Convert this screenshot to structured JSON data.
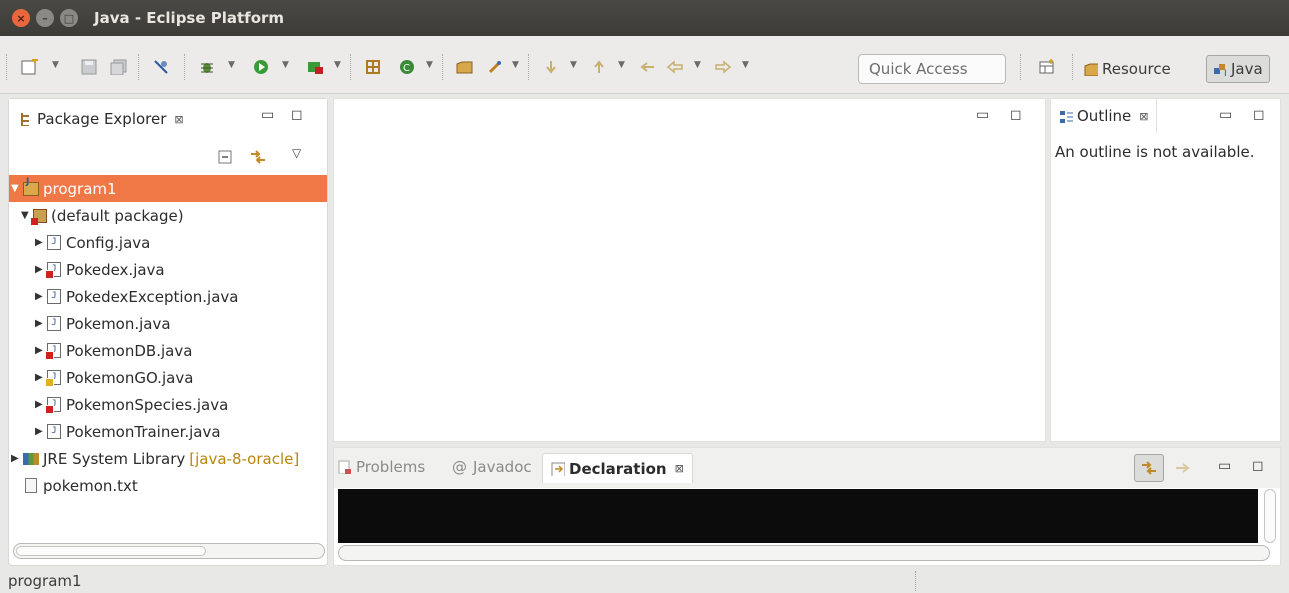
{
  "window": {
    "title": "Java - Eclipse Platform",
    "buttons": {
      "close": "×",
      "minimize": "–",
      "maximize": "□"
    }
  },
  "toolbar": {
    "quick_access_placeholder": "Quick Access",
    "perspectives": [
      {
        "label": "Resource"
      },
      {
        "label": "Java"
      }
    ],
    "icons": [
      "new-icon",
      "save-icon",
      "save-all-icon",
      "skip-breakpoints-icon",
      "debug-icon",
      "run-icon",
      "external-tools-icon",
      "new-java-project-icon",
      "new-class-icon",
      "open-type-icon",
      "search-icon",
      "next-annotation-icon",
      "prev-annotation-icon",
      "last-edit-icon",
      "back-icon",
      "forward-icon"
    ]
  },
  "package_explorer": {
    "title": "Package Explorer",
    "close_glyph": "⊠",
    "tree": [
      {
        "label": "program1",
        "kind": "project",
        "arrow": "▼",
        "selected": true
      },
      {
        "label": "(default package)",
        "kind": "package",
        "arrow": "▼"
      },
      {
        "label": "Config.java",
        "kind": "java",
        "arrow": "▶"
      },
      {
        "label": "Pokedex.java",
        "kind": "java-error",
        "arrow": "▶"
      },
      {
        "label": "PokedexException.java",
        "kind": "java",
        "arrow": "▶"
      },
      {
        "label": "Pokemon.java",
        "kind": "java",
        "arrow": "▶"
      },
      {
        "label": "PokemonDB.java",
        "kind": "java-error",
        "arrow": "▶"
      },
      {
        "label": "PokemonGO.java",
        "kind": "java-warning",
        "arrow": "▶"
      },
      {
        "label": "PokemonSpecies.java",
        "kind": "java-error",
        "arrow": "▶"
      },
      {
        "label": "PokemonTrainer.java",
        "kind": "java",
        "arrow": "▶"
      },
      {
        "label": "JRE System Library",
        "extra": "[java-8-oracle]",
        "kind": "library",
        "arrow": "▶"
      },
      {
        "label": "pokemon.txt",
        "kind": "text",
        "arrow": ""
      }
    ]
  },
  "outline": {
    "title": "Outline",
    "close_glyph": "⊠",
    "message": "An outline is not available."
  },
  "bottom": {
    "tabs": [
      {
        "label": "Problems",
        "active": false
      },
      {
        "label": "Javadoc",
        "prefix": "@",
        "active": false
      },
      {
        "label": "Declaration",
        "active": true,
        "close_glyph": "⊠"
      }
    ]
  },
  "status": {
    "text": "program1"
  },
  "colors": {
    "selection": "#f07746",
    "titlebar": "#3c3b37",
    "close_button": "#e9673f"
  }
}
